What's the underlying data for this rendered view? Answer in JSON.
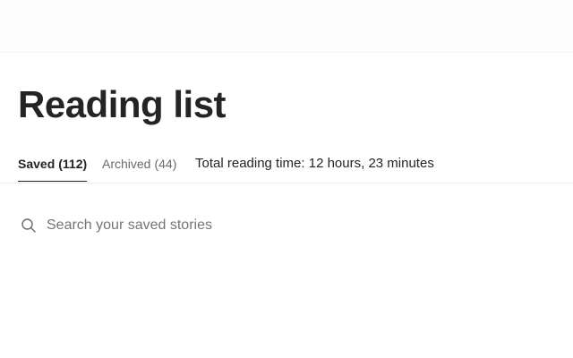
{
  "page": {
    "title": "Reading list"
  },
  "tabs": [
    {
      "label": "Saved",
      "count": "(112)"
    },
    {
      "label": "Archived",
      "count": "(44)"
    }
  ],
  "reading_time": "Total reading time: 12 hours, 23 minutes",
  "search": {
    "placeholder": "Search your saved stories",
    "icon": "search-icon"
  }
}
